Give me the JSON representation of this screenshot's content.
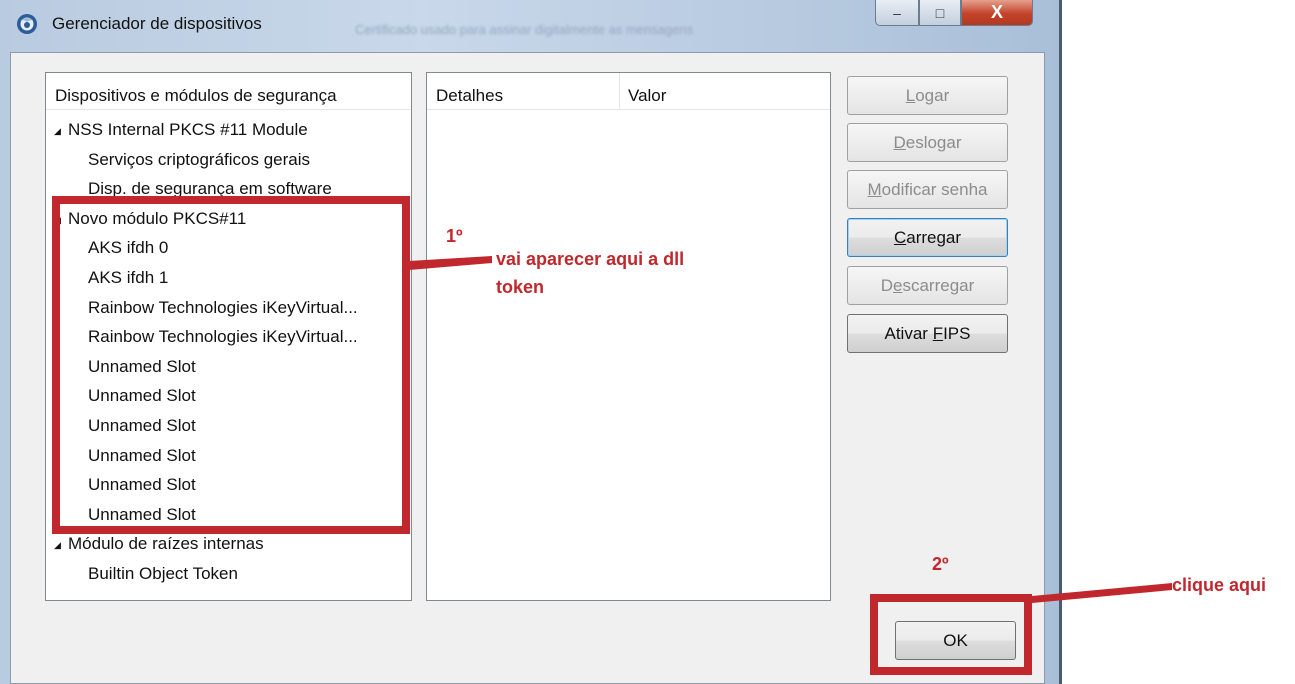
{
  "window": {
    "title": "Gerenciador de dispositivos",
    "background_title": "Certificado usado para assinar digitalmente as mensagens",
    "minimize_glyph": "‒",
    "maximize_glyph": "□",
    "close_glyph": "X"
  },
  "devices": {
    "header": "Dispositivos e módulos de segurança",
    "items": [
      {
        "label": "NSS Internal PKCS #11 Module",
        "level": 0,
        "expanded": true
      },
      {
        "label": "Serviços criptográficos gerais",
        "level": 1
      },
      {
        "label": "Disp. de segurança em software",
        "level": 1
      },
      {
        "label": "Novo módulo PKCS#11",
        "level": 0,
        "expanded": true
      },
      {
        "label": "AKS ifdh 0",
        "level": 1
      },
      {
        "label": "AKS ifdh 1",
        "level": 1
      },
      {
        "label": "Rainbow Technologies iKeyVirtual...",
        "level": 1
      },
      {
        "label": "Rainbow Technologies iKeyVirtual...",
        "level": 1
      },
      {
        "label": "Unnamed Slot",
        "level": 1
      },
      {
        "label": "Unnamed Slot",
        "level": 1
      },
      {
        "label": "Unnamed Slot",
        "level": 1
      },
      {
        "label": "Unnamed Slot",
        "level": 1
      },
      {
        "label": "Unnamed Slot",
        "level": 1
      },
      {
        "label": "Unnamed Slot",
        "level": 1
      },
      {
        "label": "Módulo de raízes internas",
        "level": 0,
        "expanded": true
      },
      {
        "label": "Builtin Object Token",
        "level": 1
      }
    ]
  },
  "details": {
    "col_details": "Detalhes",
    "col_value": "Valor"
  },
  "buttons": {
    "logar": {
      "pre": "",
      "key": "L",
      "post": "ogar"
    },
    "deslogar": {
      "pre": "",
      "key": "D",
      "post": "eslogar"
    },
    "modificar_senha": {
      "pre": "",
      "key": "M",
      "post": "odificar senha"
    },
    "carregar": {
      "pre": "",
      "key": "C",
      "post": "arregar"
    },
    "descarregar": {
      "pre": "D",
      "key": "e",
      "post": "scarregar"
    },
    "ativar_fips": {
      "pre": "Ativar ",
      "key": "F",
      "post": "IPS"
    },
    "ok": "OK"
  },
  "annotations": {
    "step1_number": "1º",
    "step1_line1": "vai aparecer aqui a dll",
    "step1_line2": "token",
    "step2_number": "2º",
    "step2_text": "clique aqui",
    "color": "#c0282d"
  },
  "icons": {
    "app": "firefox-thunderbird-icon",
    "expander": "triangle-expanded-icon"
  }
}
